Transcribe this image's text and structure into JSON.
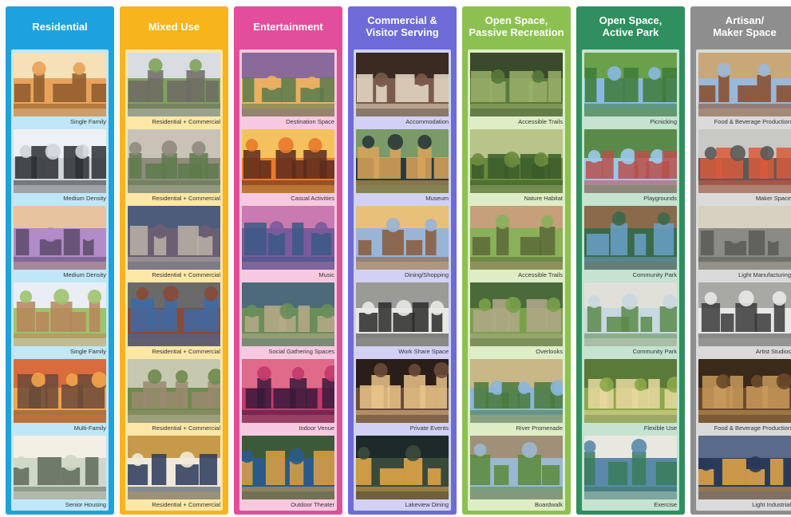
{
  "columns": [
    {
      "title": "Residential",
      "color": "#1ea2df",
      "light": "#bfe7f7",
      "tiles": [
        {
          "caption": "Single Family",
          "palette": [
            "#e9a25a",
            "#8c5a2b",
            "#f5e1b8"
          ],
          "scene": "autumn-homes"
        },
        {
          "caption": "Medium Density",
          "palette": [
            "#cfd6dc",
            "#2c2f33",
            "#eef1f4"
          ],
          "scene": "townhouses"
        },
        {
          "caption": "Medium Density",
          "palette": [
            "#b28bc9",
            "#5a4a68",
            "#e7c3a0"
          ],
          "scene": "dusk-street"
        },
        {
          "caption": "Single Family",
          "palette": [
            "#9ec36d",
            "#b9855b",
            "#e8eef4"
          ],
          "scene": "family-walk"
        },
        {
          "caption": "Multi-Family",
          "palette": [
            "#f1a44b",
            "#6b4a3a",
            "#d86c3c"
          ],
          "scene": "sunset-town"
        },
        {
          "caption": "Senior Housing",
          "palette": [
            "#cfd8c8",
            "#5d6b5a",
            "#f3efe4"
          ],
          "scene": "cafe-seniors"
        }
      ]
    },
    {
      "title": "Mixed Use",
      "color": "#f7b41d",
      "light": "#fce7a6",
      "tiles": [
        {
          "caption": "Residential + Commercial",
          "palette": [
            "#7fa35b",
            "#6e6a65",
            "#d9dde1"
          ],
          "scene": "street-trees"
        },
        {
          "caption": "Residential + Commercial",
          "palette": [
            "#8f8b7d",
            "#5e7a4a",
            "#c8c3b6"
          ],
          "scene": "aerial-block"
        },
        {
          "caption": "Residential + Commercial",
          "palette": [
            "#6a5f72",
            "#b8b2a6",
            "#4d5c7a"
          ],
          "scene": "apartment-block"
        },
        {
          "caption": "Residential + Commercial",
          "palette": [
            "#8a4a36",
            "#3c6aa6",
            "#6a6a6a"
          ],
          "scene": "brick-building"
        },
        {
          "caption": "Residential + Commercial",
          "palette": [
            "#6e8a4c",
            "#9a8a70",
            "#c6c8b0"
          ],
          "scene": "aerial-village"
        },
        {
          "caption": "Residential + Commercial",
          "palette": [
            "#f2ead8",
            "#2a3a5c",
            "#c79a4a"
          ],
          "scene": "night-storefront"
        }
      ]
    },
    {
      "title": "Entertainment",
      "color": "#e24e9b",
      "light": "#f7c9e0",
      "tiles": [
        {
          "caption": "Destination Space",
          "palette": [
            "#e9b060",
            "#5a7a4e",
            "#8a6a9a"
          ],
          "scene": "river-aerial"
        },
        {
          "caption": "Casual Activities",
          "palette": [
            "#e87a2c",
            "#5a2a1c",
            "#f3c25c"
          ],
          "scene": "firepit"
        },
        {
          "caption": "Music",
          "palette": [
            "#7b5a9c",
            "#3a5a86",
            "#c97ab0"
          ],
          "scene": "crowd"
        },
        {
          "caption": "Social Gathering Spaces",
          "palette": [
            "#6a8e5a",
            "#b7a98a",
            "#4c6a7a"
          ],
          "scene": "plaza-aerial"
        },
        {
          "caption": "Indoor Venue",
          "palette": [
            "#c23a6a",
            "#3a1a3c",
            "#e06a8a"
          ],
          "scene": "stage-lights"
        },
        {
          "caption": "Outdoor Theater",
          "palette": [
            "#2a5a8a",
            "#e0a040",
            "#3c5a3a"
          ],
          "scene": "amphitheater"
        }
      ]
    },
    {
      "title": "Commercial &\nVisitor Serving",
      "color": "#6d6bd8",
      "light": "#d2d1f4",
      "tiles": [
        {
          "caption": "Accommodation",
          "palette": [
            "#7a5a4a",
            "#e8dcc8",
            "#3a2a22"
          ],
          "scene": "hotel-room"
        },
        {
          "caption": "Museum",
          "palette": [
            "#2a3a3a",
            "#d9a45a",
            "#7a9a6a"
          ],
          "scene": "lit-building"
        },
        {
          "caption": "Dining/Shopping",
          "palette": [
            "#9ab4d6",
            "#8a5a3a",
            "#e8c07a"
          ],
          "scene": "shop-street"
        },
        {
          "caption": "Work Share Space",
          "palette": [
            "#e8e8e4",
            "#2a2a2a",
            "#9a9a96"
          ],
          "scene": "loft-office"
        },
        {
          "caption": "Private Events",
          "palette": [
            "#6a4a3a",
            "#e9c48a",
            "#2a1e18"
          ],
          "scene": "event-hall"
        },
        {
          "caption": "Lakeview Dining",
          "palette": [
            "#3a4a3a",
            "#e8a848",
            "#1e2a2a"
          ],
          "scene": "night-dining"
        }
      ]
    },
    {
      "title": "Open Space,\nPassive Recreation",
      "color": "#8cc152",
      "light": "#ddeec6",
      "tiles": [
        {
          "caption": "Accessible Trails",
          "palette": [
            "#5a7a3c",
            "#9ab06a",
            "#3a4a2a"
          ],
          "scene": "forest-trail"
        },
        {
          "caption": "Nature Habitat",
          "palette": [
            "#6a8a3c",
            "#3a5a2a",
            "#b8c48a"
          ],
          "scene": "hikers"
        },
        {
          "caption": "Accessible Trails",
          "palette": [
            "#8ab05a",
            "#5a6a3a",
            "#c6a07a"
          ],
          "scene": "runners"
        },
        {
          "caption": "Overlooks",
          "palette": [
            "#7aa04a",
            "#b0a88a",
            "#4a6a3a"
          ],
          "scene": "terraces"
        },
        {
          "caption": "River Promenade",
          "palette": [
            "#8ab6d8",
            "#4a7a3a",
            "#c8b888"
          ],
          "scene": "promenade"
        },
        {
          "caption": "Boardwalk",
          "palette": [
            "#9ab8d0",
            "#5a8a3a",
            "#a09078"
          ],
          "scene": "boardwalk"
        }
      ]
    },
    {
      "title": "Open Space,\nActive Park",
      "color": "#2f8f5f",
      "light": "#c4e3d1",
      "tiles": [
        {
          "caption": "Picnicking",
          "palette": [
            "#8ab8e0",
            "#3e7a3a",
            "#6aa04a"
          ],
          "scene": "park-lawn"
        },
        {
          "caption": "Playgrounds",
          "palette": [
            "#9ac8e8",
            "#b8504a",
            "#5a8a4a"
          ],
          "scene": "playground"
        },
        {
          "caption": "Community Park",
          "palette": [
            "#3a6a4a",
            "#6aa0c8",
            "#8a6a4a"
          ],
          "scene": "lake-bridge"
        },
        {
          "caption": "Community Park",
          "palette": [
            "#c8d8e0",
            "#5a8a4a",
            "#e0e0d8"
          ],
          "scene": "park-path"
        },
        {
          "caption": "Flexible Use",
          "palette": [
            "#8aa84a",
            "#e8d8a0",
            "#5a7a3a"
          ],
          "scene": "yoga-lawn"
        },
        {
          "caption": "Exercise",
          "palette": [
            "#5a8aa8",
            "#3a7a5a",
            "#e8e8e0"
          ],
          "scene": "tennis"
        }
      ]
    },
    {
      "title": "Artisan/\nMaker Space",
      "color": "#8e8e8e",
      "light": "#dadada",
      "tiles": [
        {
          "caption": "Food & Beverage Production",
          "palette": [
            "#9ab8d8",
            "#8a4a2a",
            "#c8a878"
          ],
          "scene": "brewery-exterior"
        },
        {
          "caption": "Maker Space",
          "palette": [
            "#5a5a5a",
            "#d85a3a",
            "#c8c8c4"
          ],
          "scene": "workshop"
        },
        {
          "caption": "Light Manufacturing",
          "palette": [
            "#8a8a86",
            "#5a5a56",
            "#d8d0c0"
          ],
          "scene": "factory-floor"
        },
        {
          "caption": "Artist Studios",
          "palette": [
            "#e8e8e8",
            "#3a3a3a",
            "#a8a8a4"
          ],
          "scene": "studio"
        },
        {
          "caption": "Food & Beverage Production",
          "palette": [
            "#6a4a2a",
            "#c89a5a",
            "#3a2a1a"
          ],
          "scene": "barrels"
        },
        {
          "caption": "Light Industrial",
          "palette": [
            "#2a3a5a",
            "#e8a848",
            "#5a6a8a"
          ],
          "scene": "night-facility"
        }
      ]
    }
  ]
}
